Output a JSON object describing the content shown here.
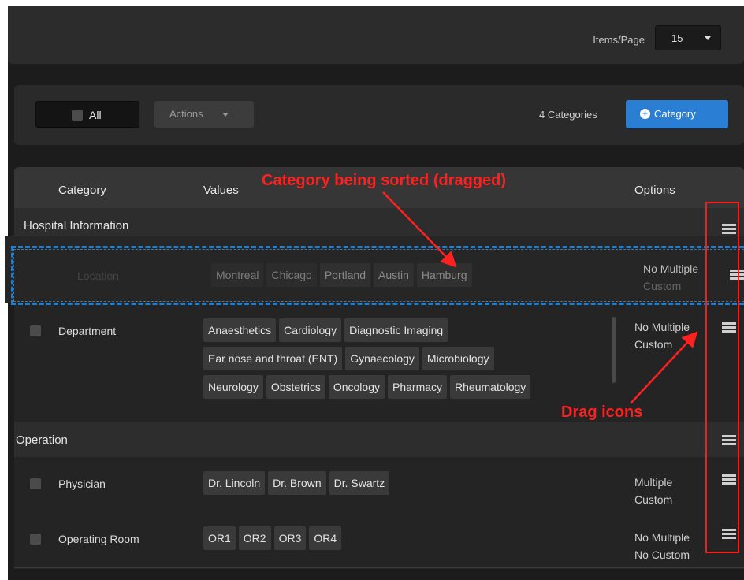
{
  "header": {
    "items_per_page_label": "Items/Page",
    "items_per_page_value": "15"
  },
  "toolbar": {
    "all_label": "All",
    "actions_label": "Actions",
    "count_text": "4 Categories",
    "add_button_label": "Category"
  },
  "table": {
    "columns": [
      "Category",
      "Values",
      "Options"
    ],
    "groups": [
      {
        "label": "Hospital Information",
        "rows": [
          {
            "name": "Location",
            "values": [
              "Montreal",
              "Chicago",
              "Portland",
              "Austin",
              "Hamburg"
            ],
            "options": [
              "No Multiple",
              "Custom"
            ],
            "state": "being dragged"
          },
          {
            "name": "Department",
            "values": [
              "Anaesthetics",
              "Cardiology",
              "Diagnostic Imaging",
              "Ear nose and throat (ENT)",
              "Gynaecology",
              "Microbiology",
              "Neurology",
              "Obstetrics",
              "Oncology",
              "Pharmacy",
              "Rheumatology"
            ],
            "options": [
              "No Multiple",
              "Custom"
            ]
          }
        ]
      },
      {
        "label": "Operation",
        "rows": [
          {
            "name": "Physician",
            "values": [
              "Dr. Lincoln",
              "Dr. Brown",
              "Dr. Swartz"
            ],
            "options": [
              "Multiple",
              "Custom"
            ]
          },
          {
            "name": "Operating Room",
            "values": [
              "OR1",
              "OR2",
              "OR3",
              "OR4"
            ],
            "options": [
              "No Multiple",
              "No Custom"
            ]
          }
        ]
      }
    ]
  },
  "annotations": {
    "sorted_callout": "Category being sorted (dragged)",
    "drag_callout": "Drag icons",
    "color": "#ff2020",
    "drop_outline_color": "#1e7fd0"
  },
  "colors": {
    "primary": "#2a7fd4",
    "background": "#1c1c1c"
  },
  "icons": [
    "caret-down-icon",
    "plus-circle-icon",
    "drag-handle-icon",
    "checkbox-icon"
  ]
}
